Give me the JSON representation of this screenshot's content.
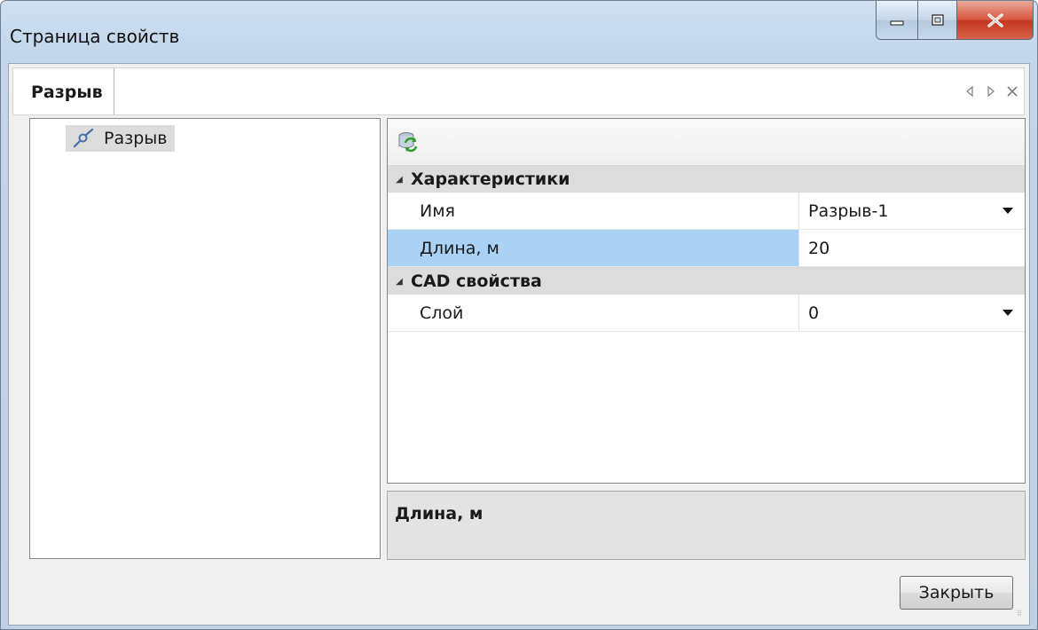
{
  "window": {
    "title": "Страница свойств"
  },
  "tabs": {
    "active_label": "Разрыв"
  },
  "tree": {
    "items": [
      {
        "label": "Разрыв",
        "icon": "break-line-icon",
        "selected": true
      }
    ]
  },
  "property_grid": {
    "categories": [
      {
        "label": "Характеристики",
        "rows": [
          {
            "name": "Имя",
            "value": "Разрыв-1",
            "dropdown": true
          },
          {
            "name": "Длина, м",
            "value": "20",
            "dropdown": false
          }
        ]
      },
      {
        "label": "CAD свойства",
        "rows": [
          {
            "name": "Слой",
            "value": "0",
            "dropdown": true
          }
        ]
      }
    ],
    "selected_row": "Длина, м",
    "description_title": "Длина, м"
  },
  "buttons": {
    "close_label": "Закрыть"
  },
  "colors": {
    "selection": "#aad2f6",
    "category_bg": "#dcdcdc",
    "close_button_red": "#c2371f"
  }
}
